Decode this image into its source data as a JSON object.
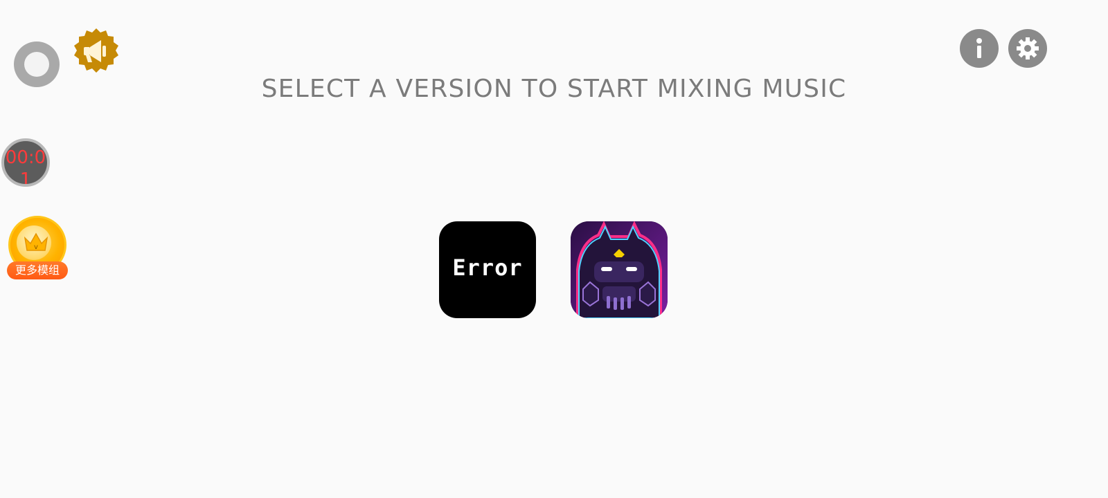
{
  "header": {
    "title": "SELECT A VERSION TO START MIXING MUSIC"
  },
  "overlay": {
    "timer_text": "00:01",
    "more_mods_label": "更多模组"
  },
  "icons": {
    "toggle": "circle-toggle-icon",
    "announce": "megaphone-badge-icon",
    "info": "info-icon",
    "settings": "gear-icon",
    "crown": "crown-icon"
  },
  "versions": [
    {
      "label": "Error"
    },
    {
      "label": ""
    }
  ],
  "colors": {
    "background": "#fafafa",
    "title": "#7b7b7b",
    "icon_button": "#8a8a8a",
    "badge_gold": "#c68a06",
    "timer_text": "#ff3b3b"
  }
}
